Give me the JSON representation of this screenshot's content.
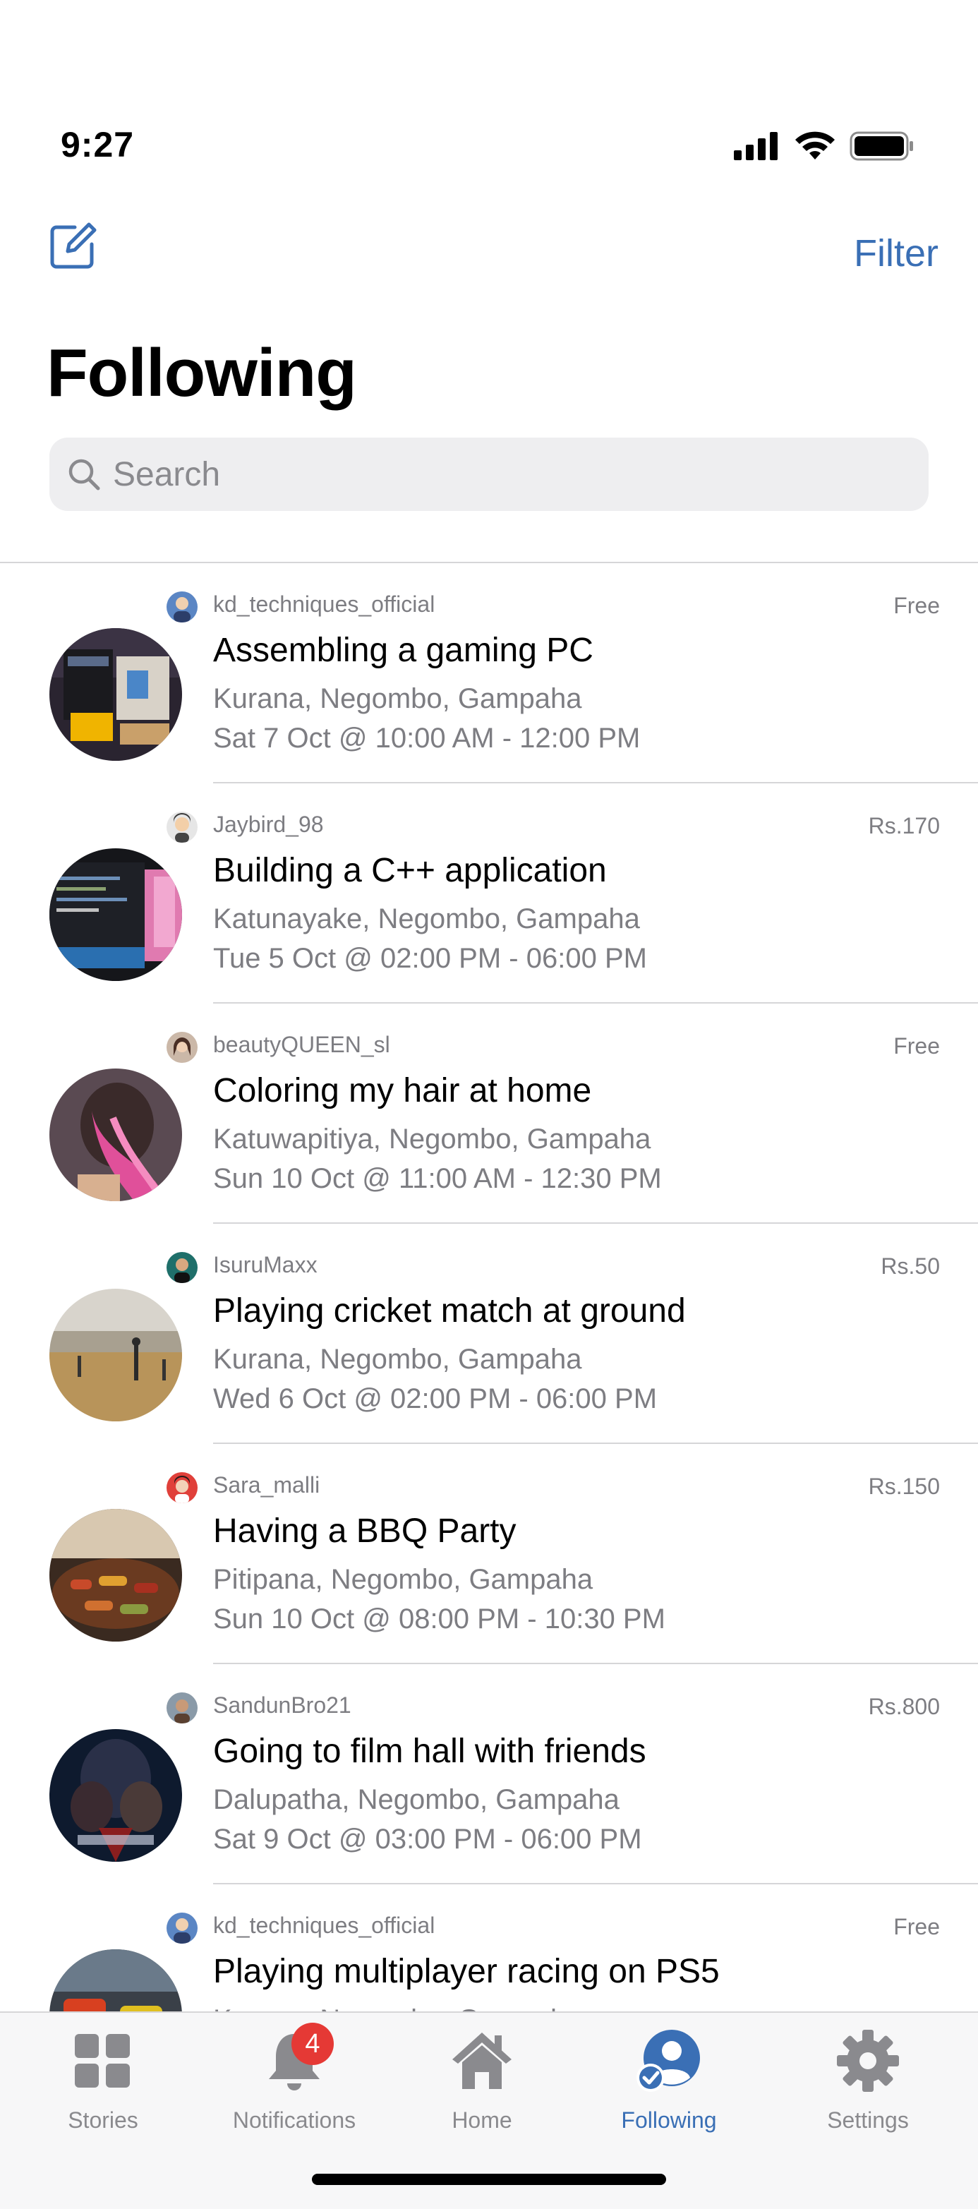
{
  "status_bar": {
    "time": "9:27"
  },
  "nav": {
    "filter_label": "Filter"
  },
  "page_title": "Following",
  "search": {
    "placeholder": "Search"
  },
  "feed": [
    {
      "username": "kd_techniques_official",
      "price": "Free",
      "title": "Assembling a gaming PC",
      "location": "Kurana, Negombo, Gampaha",
      "datetime": "Sat 7 Oct @ 10:00 AM - 12:00 PM"
    },
    {
      "username": "Jaybird_98",
      "price": "Rs.170",
      "title": "Building a C++ application",
      "location": "Katunayake, Negombo, Gampaha",
      "datetime": "Tue 5 Oct @ 02:00 PM - 06:00 PM"
    },
    {
      "username": "beautyQUEEN_sl",
      "price": "Free",
      "title": "Coloring my hair at home",
      "location": "Katuwapitiya, Negombo, Gampaha",
      "datetime": "Sun 10 Oct @ 11:00 AM - 12:30 PM"
    },
    {
      "username": "IsuruMaxx",
      "price": "Rs.50",
      "title": "Playing cricket match at ground",
      "location": "Kurana, Negombo, Gampaha",
      "datetime": "Wed 6 Oct @ 02:00 PM - 06:00 PM"
    },
    {
      "username": "Sara_malli",
      "price": "Rs.150",
      "title": "Having a BBQ Party",
      "location": "Pitipana, Negombo, Gampaha",
      "datetime": "Sun 10 Oct @ 08:00 PM - 10:30 PM"
    },
    {
      "username": "SandunBro21",
      "price": "Rs.800",
      "title": "Going to film hall with friends",
      "location": "Dalupatha, Negombo, Gampaha",
      "datetime": "Sat 9 Oct @ 03:00 PM - 06:00 PM"
    },
    {
      "username": "kd_techniques_official",
      "price": "Free",
      "title": "Playing multiplayer racing on PS5",
      "location": "Kurana, Negombo, Gampaha",
      "datetime": ""
    }
  ],
  "tab_bar": {
    "tabs": [
      {
        "label": "Stories",
        "icon": "grid-icon"
      },
      {
        "label": "Notifications",
        "icon": "bell-icon",
        "badge": "4"
      },
      {
        "label": "Home",
        "icon": "house-icon"
      },
      {
        "label": "Following",
        "icon": "person-check-icon",
        "active": true
      },
      {
        "label": "Settings",
        "icon": "gear-icon"
      }
    ]
  },
  "colors": {
    "accent": "#3a6fb5",
    "badge": "#e53935",
    "secondary_text": "#7d7d82"
  }
}
